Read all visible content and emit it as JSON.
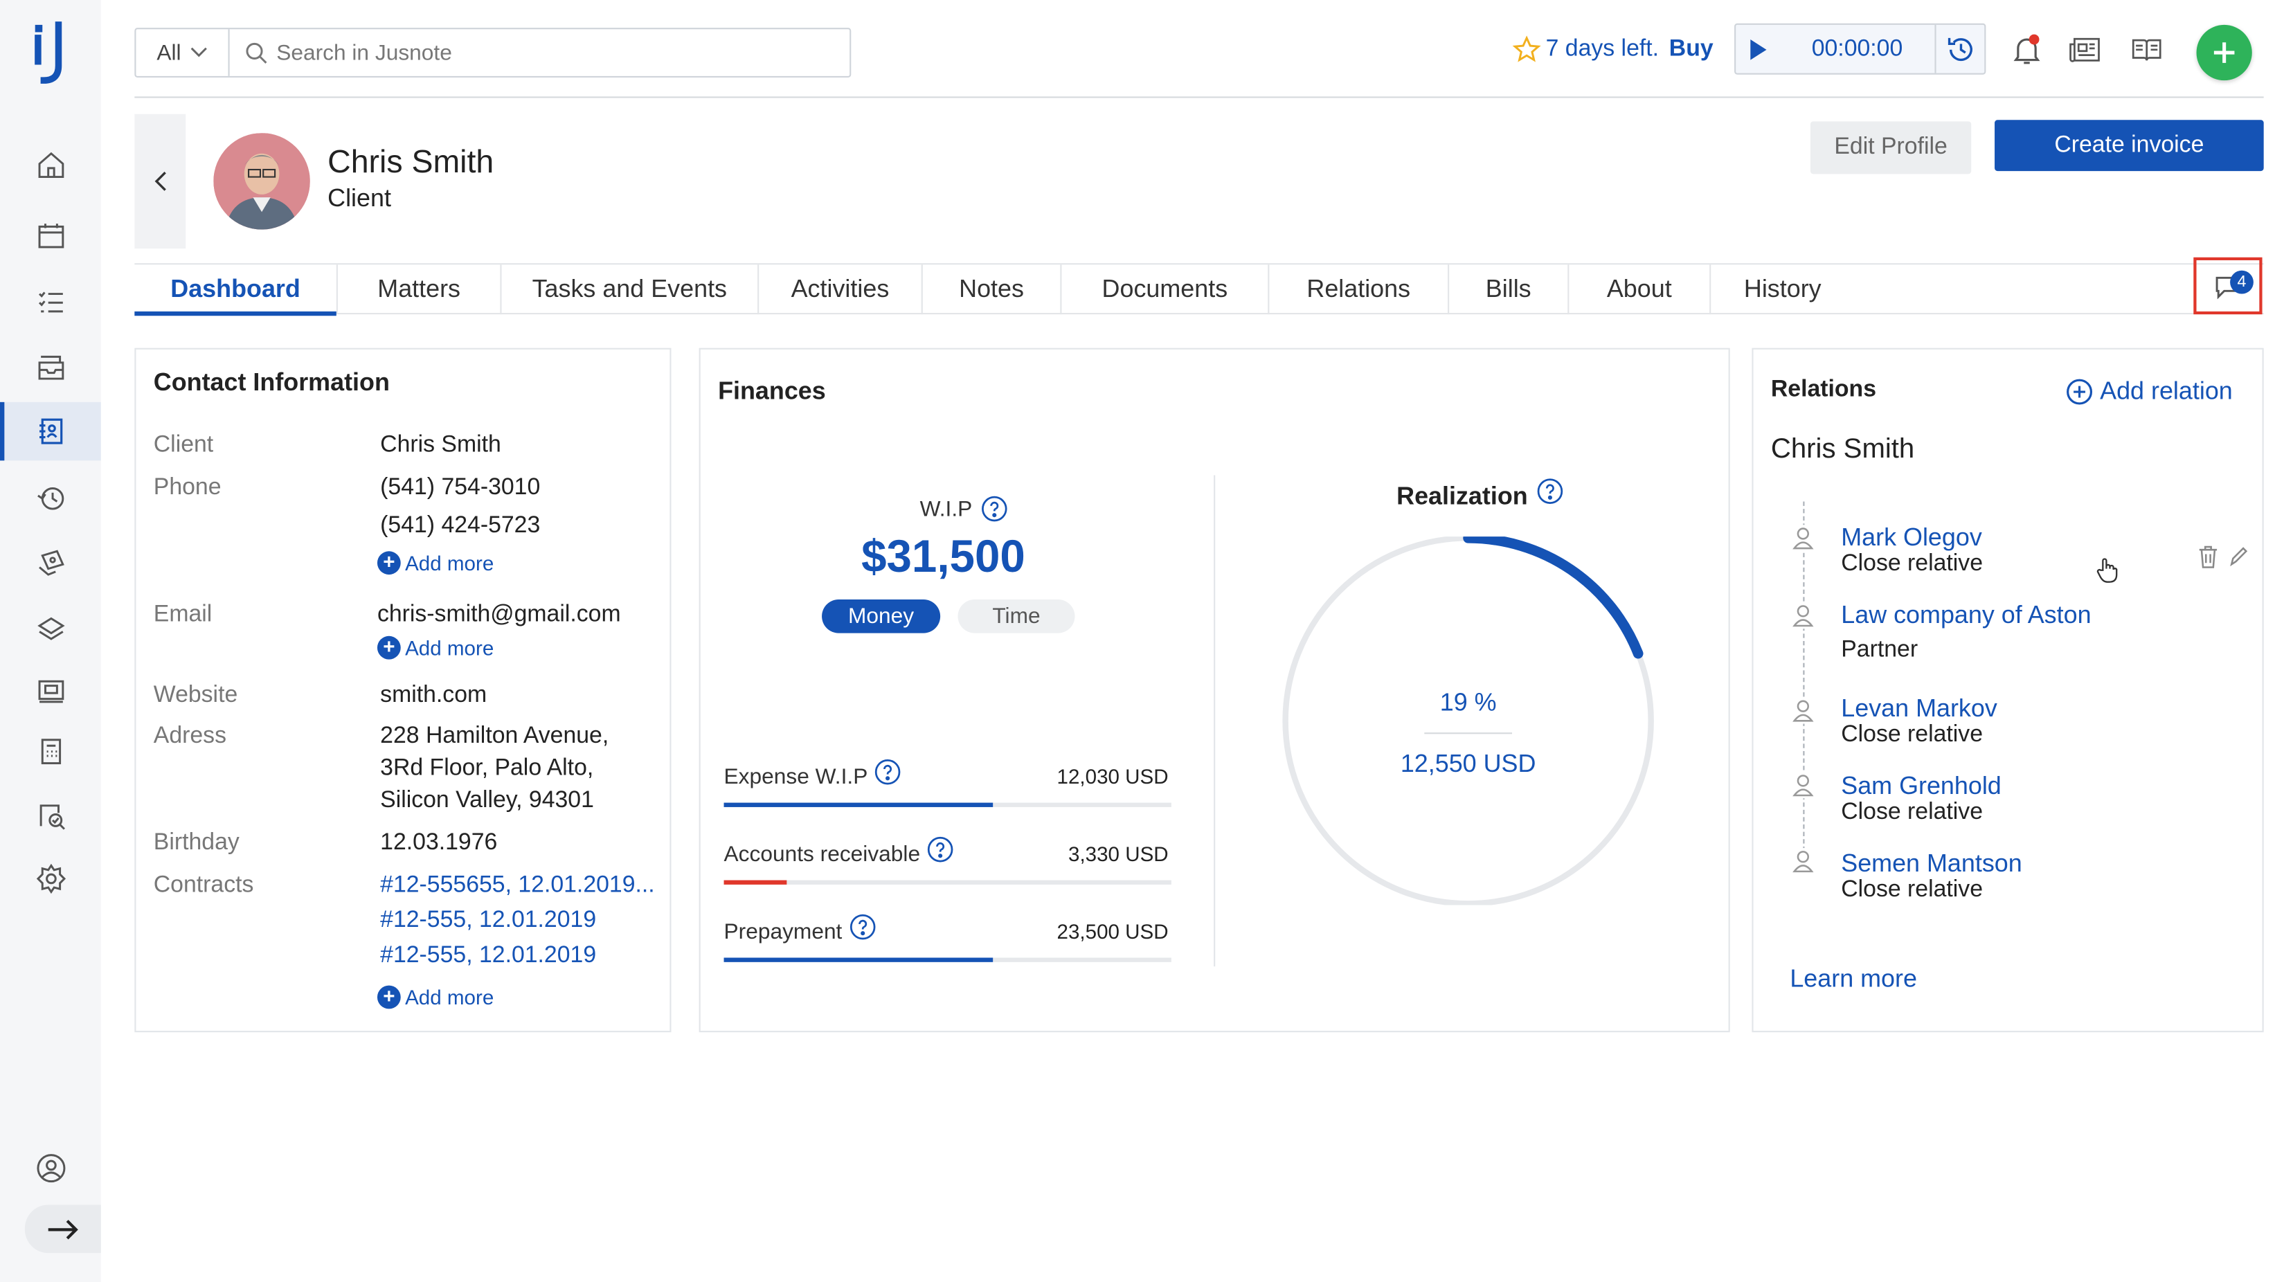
{
  "app": {
    "logo_alt": "Jusnote"
  },
  "topbar": {
    "scope": "All",
    "search_placeholder": "Search in Jusnote",
    "trial_text": "7 days left.",
    "trial_buy": "Buy",
    "timer": "00:00:00"
  },
  "sidebar": {
    "items": [
      {
        "icon": "home-icon"
      },
      {
        "icon": "calendar-icon"
      },
      {
        "icon": "tasks-list-icon"
      },
      {
        "icon": "inbox-icon"
      },
      {
        "icon": "contacts-icon",
        "active": true
      },
      {
        "icon": "history-icon"
      },
      {
        "icon": "money-hand-icon"
      },
      {
        "icon": "bank-icon"
      },
      {
        "icon": "billing-icon"
      },
      {
        "icon": "calculator-icon"
      },
      {
        "icon": "reports-icon"
      },
      {
        "icon": "settings-icon"
      }
    ]
  },
  "profile": {
    "name": "Chris Smith",
    "role": "Client",
    "edit_label": "Edit Profile",
    "invoice_label": "Create invoice"
  },
  "tabs": [
    "Dashboard",
    "Matters",
    "Tasks and Events",
    "Activities",
    "Notes",
    "Documents",
    "Relations",
    "Bills",
    "About",
    "History"
  ],
  "chat_count": "4",
  "contact": {
    "title": "Contact Information",
    "client_label": "Client",
    "client": "Chris Smith",
    "phone_label": "Phone",
    "phone1": "(541) 754-3010",
    "phone2": "(541) 424-5723",
    "add_more": "Add more",
    "email_label": "Email",
    "email": "chris-smith@gmail.com",
    "website_label": "Website",
    "website": "smith.com",
    "address_label": "Adress",
    "address1": "228 Hamilton Avenue,",
    "address2": "3Rd Floor, Palo Alto,",
    "address3": "Silicon Valley, 94301",
    "birthday_label": "Birthday",
    "birthday": "12.03.1976",
    "contracts_label": "Contracts",
    "contract1": "#12-555655, 12.01.2019...",
    "contract2": "#12-555, 12.01.2019",
    "contract3": "#12-555, 12.01.2019"
  },
  "finances": {
    "title": "Finances",
    "wip_label": "W.I.P",
    "wip_value": "$31,500",
    "toggle_money": "Money",
    "toggle_time": "Time",
    "rows": [
      {
        "label": "Expense W.I.P",
        "amount": "12,030 USD",
        "progress": 0.6,
        "color": "#1553b5"
      },
      {
        "label": "Accounts receivable",
        "amount": "3,330 USD",
        "progress": 0.14,
        "color": "#e0372b"
      },
      {
        "label": "Prepayment",
        "amount": "23,500 USD",
        "progress": 0.6,
        "color": "#1553b5"
      }
    ],
    "realization_title": "Realization",
    "realization_pct": "19 %",
    "realization_fraction": 0.19,
    "realization_usd": "12,550 USD"
  },
  "relations": {
    "title": "Relations",
    "add_label": "Add relation",
    "person": "Chris Smith",
    "items": [
      {
        "name": "Mark Olegov",
        "type": "Close relative"
      },
      {
        "name": "Law company of Aston",
        "type": "Partner"
      },
      {
        "name": "Levan Markov",
        "type": "Close relative"
      },
      {
        "name": "Sam Grenhold",
        "type": "Close relative"
      },
      {
        "name": "Semen Mantson",
        "type": "Close relative"
      }
    ],
    "learn_more": "Learn more"
  },
  "colors": {
    "primary": "#1553b5",
    "success": "#2eb35a",
    "danger": "#e0372b",
    "star": "#f2b01e"
  }
}
